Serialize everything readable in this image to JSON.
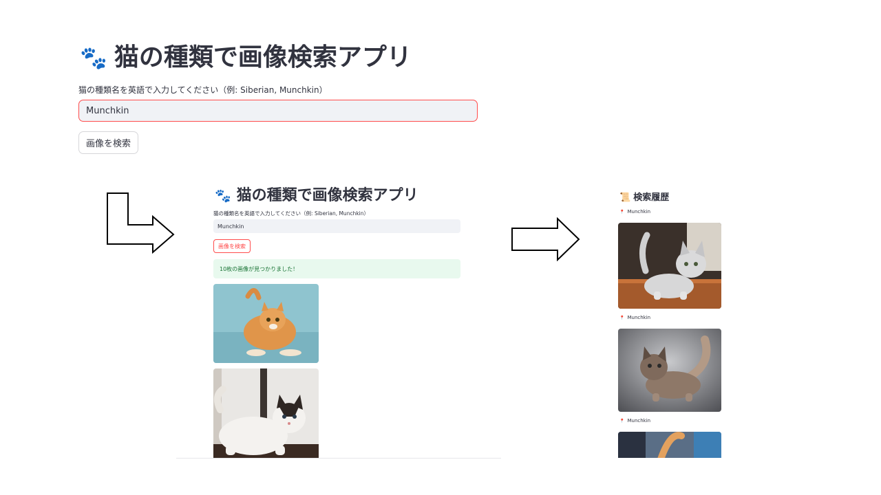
{
  "app": {
    "title": "猫の種類で画像検索アプリ",
    "title_icon": "paw-icon",
    "input_label": "猫の種類名を英語で入力してください（例: Siberian, Munchkin）",
    "input_value": "Munchkin",
    "search_button": "画像を検索"
  },
  "result_view": {
    "title": "猫の種類で画像検索アプリ",
    "input_label": "猫の種類名を英語で入力してください（例: Siberian, Munchkin）",
    "input_value": "Munchkin",
    "search_button": "画像を検索",
    "success_message": "10枚の画像が見つかりました！",
    "images": [
      "orange-kitten-photo",
      "calico-munchkin-photo"
    ]
  },
  "history": {
    "title": "検索履歴",
    "title_icon": "scroll-icon",
    "item_icon": "pin-icon",
    "items": [
      {
        "label": "Munchkin",
        "image": "silver-munchkin-photo"
      },
      {
        "label": "Munchkin",
        "image": "fluffy-munchkin-photo"
      },
      {
        "label": "Munchkin",
        "image": "orange-cat-photo"
      }
    ]
  },
  "colors": {
    "accent": "#ff4b4b",
    "success_bg": "#e8f9ee",
    "success_text": "#177233",
    "input_bg": "#f0f2f6",
    "text": "#31333f"
  }
}
